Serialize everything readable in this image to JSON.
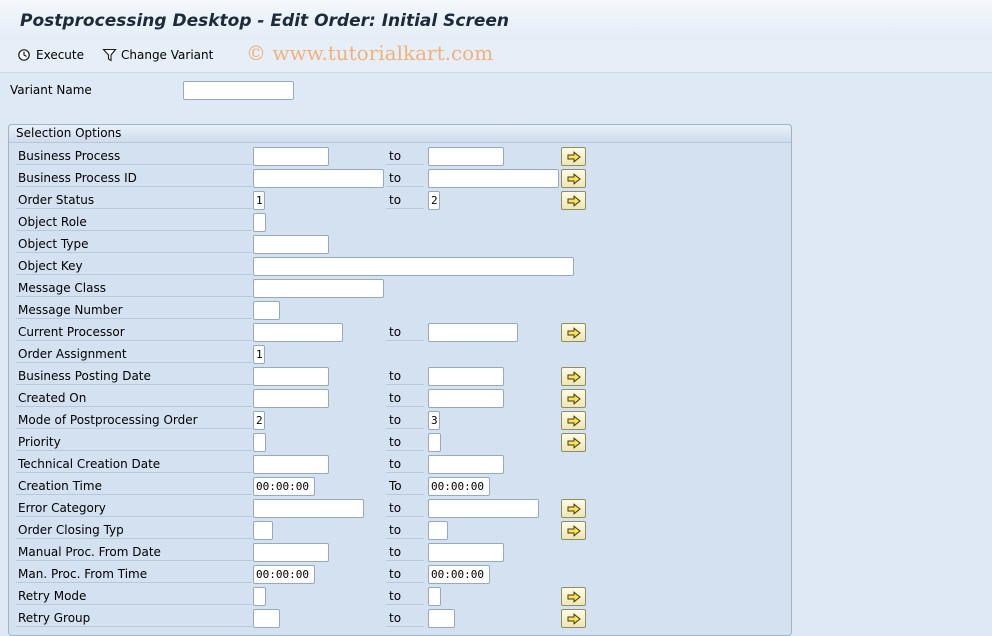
{
  "window": {
    "title": "Postprocessing Desktop  - Edit Order: Initial Screen"
  },
  "toolbar": {
    "execute_label": "Execute",
    "change_variant_label": "Change Variant"
  },
  "watermark": "© www.tutorialkart.com",
  "variant": {
    "label": "Variant Name",
    "value": ""
  },
  "selection": {
    "title": "Selection Options",
    "to_label": "to",
    "rows": [
      {
        "label": "Business Process",
        "from": "",
        "to_text": "to",
        "to": ""
      },
      {
        "label": "Business Process ID",
        "from": "",
        "to_text": "to",
        "to": ""
      },
      {
        "label": "Order Status",
        "from": "1",
        "to_text": "to",
        "to": "2"
      },
      {
        "label": "Object Role",
        "from": ""
      },
      {
        "label": "Object Type",
        "from": ""
      },
      {
        "label": "Object Key",
        "from": ""
      },
      {
        "label": "Message Class",
        "from": ""
      },
      {
        "label": "Message Number",
        "from": ""
      },
      {
        "label": "Current Processor",
        "from": "",
        "to_text": "to",
        "to": ""
      },
      {
        "label": "Order Assignment",
        "from": "1"
      },
      {
        "label": "Business Posting Date",
        "from": "",
        "to_text": "to",
        "to": ""
      },
      {
        "label": "Created On",
        "from": "",
        "to_text": "to",
        "to": ""
      },
      {
        "label": "Mode of Postprocessing Order",
        "from": "2",
        "to_text": "to",
        "to": "3"
      },
      {
        "label": "Priority",
        "from": "",
        "to_text": "to",
        "to": ""
      },
      {
        "label": "Technical Creation Date",
        "from": "",
        "to_text": "to",
        "to": ""
      },
      {
        "label": "Creation Time",
        "from": "00:00:00",
        "to_text": "To",
        "to": "00:00:00"
      },
      {
        "label": "Error Category",
        "from": "",
        "to_text": "to",
        "to": ""
      },
      {
        "label": "Order Closing Typ",
        "from": "",
        "to_text": "to",
        "to": ""
      },
      {
        "label": "Manual Proc. From Date",
        "from": "",
        "to_text": "to",
        "to": ""
      },
      {
        "label": "Man. Proc. From Time",
        "from": "00:00:00",
        "to_text": "to",
        "to": "00:00:00"
      },
      {
        "label": "Retry Mode",
        "from": "",
        "to_text": "to",
        "to": ""
      },
      {
        "label": "Retry Group",
        "from": "",
        "to_text": "to",
        "to": ""
      }
    ]
  }
}
